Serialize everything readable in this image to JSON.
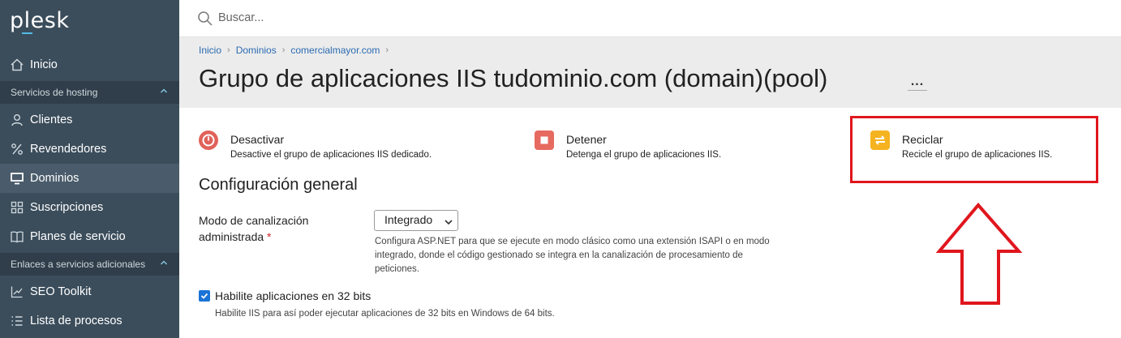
{
  "brand": {
    "logo": "plesk"
  },
  "sidebar": {
    "items": [
      {
        "label": "Inicio",
        "icon": "home-icon"
      },
      {
        "section": "Servicios de hosting"
      },
      {
        "label": "Clientes",
        "icon": "user-icon"
      },
      {
        "label": "Revendedores",
        "icon": "percent-icon"
      },
      {
        "label": "Dominios",
        "icon": "monitor-icon",
        "active": true
      },
      {
        "label": "Suscripciones",
        "icon": "grid-icon"
      },
      {
        "label": "Planes de servicio",
        "icon": "book-icon"
      },
      {
        "section": "Enlaces a servicios adicionales"
      },
      {
        "label": "SEO Toolkit",
        "icon": "chart-icon"
      },
      {
        "label": "Lista de procesos",
        "icon": "list-icon"
      }
    ]
  },
  "search": {
    "placeholder": "Buscar..."
  },
  "breadcrumb": [
    "Inicio",
    "Dominios",
    "comercialmayor.com"
  ],
  "page": {
    "title": "Grupo de aplicaciones IIS tudominio.com (domain)(pool)",
    "more": "..."
  },
  "actions": [
    {
      "title": "Desactivar",
      "desc": "Desactive el grupo de aplicaciones IIS dedicado.",
      "icon": "power-icon",
      "color": "#e0625a"
    },
    {
      "title": "Detener",
      "desc": "Detenga el grupo de aplicaciones IIS.",
      "icon": "stop-icon",
      "color": "#e66a5f"
    },
    {
      "title": "Reciclar",
      "desc": "Recicle el grupo de aplicaciones IIS.",
      "icon": "recycle-icon",
      "color": "#f5b320"
    }
  ],
  "config": {
    "title": "Configuración general",
    "pipeline": {
      "label_line1": "Modo de canalización",
      "label_line2": "administrada",
      "required": "*",
      "value": "Integrado",
      "help": "Configura ASP.NET para que se ejecute en modo clásico como una extensión ISAPI o en modo integrado, donde el código gestionado se integra en la canalización de procesamiento de peticiones."
    },
    "bits32": {
      "checked": true,
      "label": "Habilite aplicaciones en 32 bits",
      "help": "Habilite IIS para así poder ejecutar aplicaciones de 32 bits en Windows de 64 bits."
    }
  },
  "colors": {
    "sidebar": "#3b4d5b",
    "highlight": "#e0161d",
    "accent": "#1a73d6"
  }
}
